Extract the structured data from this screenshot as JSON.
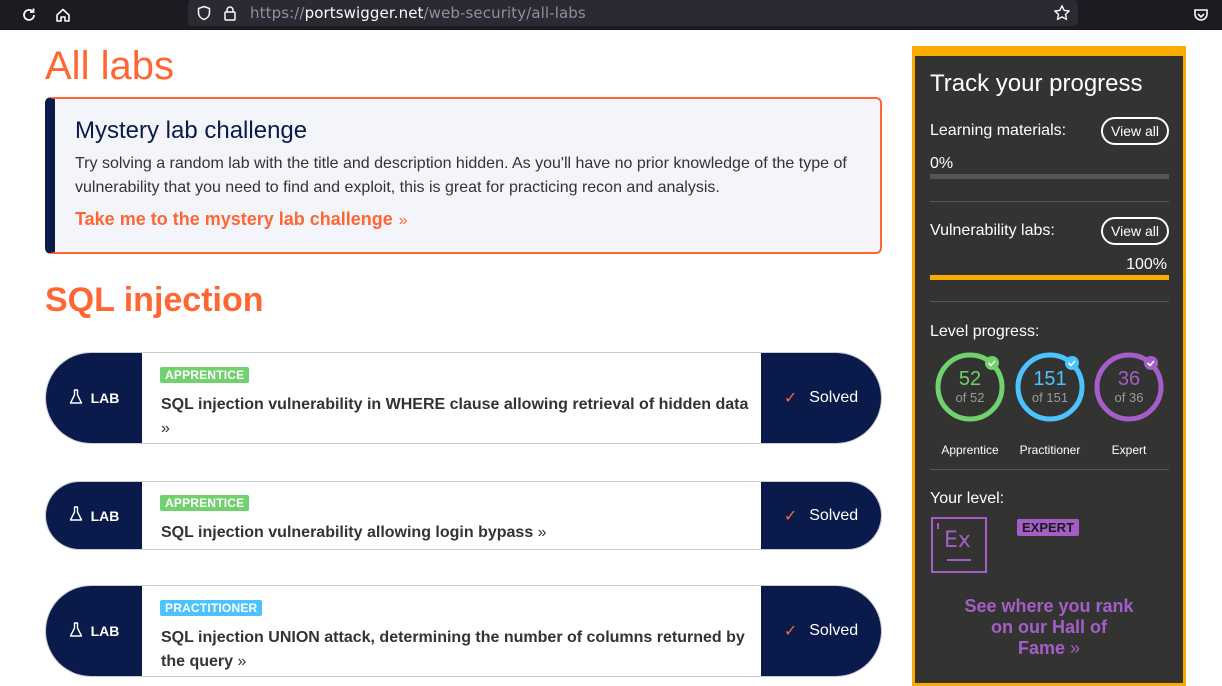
{
  "browser": {
    "url_prefix": "https://",
    "url_host": "portswigger.net",
    "url_path": "/web-security/all-labs"
  },
  "page": {
    "title": "All labs"
  },
  "mystery": {
    "title": "Mystery lab challenge",
    "description": "Try solving a random lab with the title and description hidden. As you'll have no prior knowledge of the type of vulnerability that you need to find and exploit, this is great for practicing recon and analysis.",
    "link": "Take me to the mystery lab challenge"
  },
  "section": {
    "title": "SQL injection"
  },
  "labs": [
    {
      "pill": "LAB",
      "level": "APPRENTICE",
      "title": "SQL injection vulnerability in WHERE clause allowing retrieval of hidden data",
      "status": "Solved"
    },
    {
      "pill": "LAB",
      "level": "APPRENTICE",
      "title": "SQL injection vulnerability allowing login bypass",
      "status": "Solved"
    },
    {
      "pill": "LAB",
      "level": "PRACTITIONER",
      "title": "SQL injection UNION attack, determining the number of columns returned by the query",
      "status": "Solved"
    }
  ],
  "sidebar": {
    "title": "Track your progress",
    "learning_label": "Learning materials:",
    "learning_button": "View all",
    "learning_value": "0%",
    "learning_fraction": 0,
    "vuln_label": "Vulnerability labs:",
    "vuln_button": "View all",
    "vuln_value": "100%",
    "vuln_fraction": 1,
    "level_progress_label": "Level progress:",
    "rings": [
      {
        "num": "52",
        "of": "of 52",
        "label": "Apprentice",
        "color": "#70d16d"
      },
      {
        "num": "151",
        "of": "of 151",
        "label": "Practitioner",
        "color": "#4cc3ff"
      },
      {
        "num": "36",
        "of": "of 36",
        "label": "Expert",
        "color": "#a35fc7"
      }
    ],
    "your_level_label": "Your level:",
    "level_icon_text": "Ex",
    "level_badge": "EXPERT",
    "hall_of_fame_line1": "See where you rank",
    "hall_of_fame_line2": "on our Hall of",
    "hall_of_fame_line3": "Fame"
  },
  "colors": {
    "accent": "#ff6633",
    "navy": "#0a1a4a",
    "gold": "#f9ab00"
  }
}
